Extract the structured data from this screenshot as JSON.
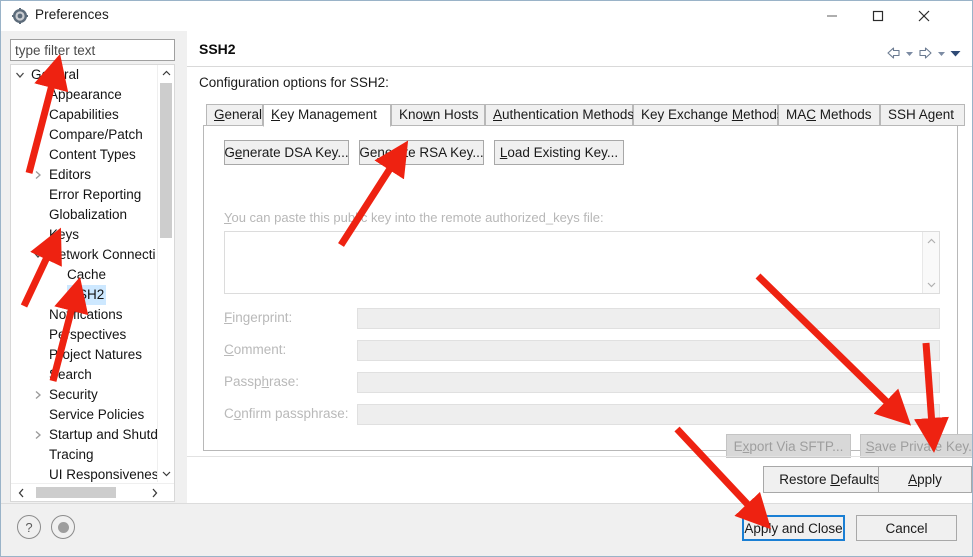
{
  "window": {
    "title": "Preferences",
    "icon": "preferences-gear-icon",
    "minimize_label": "Minimize",
    "maximize_label": "Maximize",
    "close_label": "Close"
  },
  "sidebar": {
    "filter": {
      "value": "",
      "placeholder": "type filter text"
    },
    "tree": [
      {
        "label": "General",
        "indent": 0,
        "twisty": "expanded",
        "selected": false
      },
      {
        "label": "Appearance",
        "indent": 1,
        "twisty": "none",
        "selected": false
      },
      {
        "label": "Capabilities",
        "indent": 1,
        "twisty": "none",
        "selected": false
      },
      {
        "label": "Compare/Patch",
        "indent": 1,
        "twisty": "none",
        "selected": false
      },
      {
        "label": "Content Types",
        "indent": 1,
        "twisty": "none",
        "selected": false
      },
      {
        "label": "Editors",
        "indent": 1,
        "twisty": "collapsed",
        "selected": false
      },
      {
        "label": "Error Reporting",
        "indent": 1,
        "twisty": "none",
        "selected": false
      },
      {
        "label": "Globalization",
        "indent": 1,
        "twisty": "none",
        "selected": false
      },
      {
        "label": "Keys",
        "indent": 1,
        "twisty": "none",
        "selected": false
      },
      {
        "label": "Network Connecti",
        "indent": 1,
        "twisty": "expanded",
        "selected": false
      },
      {
        "label": "Cache",
        "indent": 2,
        "twisty": "none",
        "selected": false
      },
      {
        "label": "SSH2",
        "indent": 2,
        "twisty": "none",
        "selected": true
      },
      {
        "label": "Notifications",
        "indent": 1,
        "twisty": "none",
        "selected": false
      },
      {
        "label": "Perspectives",
        "indent": 1,
        "twisty": "none",
        "selected": false
      },
      {
        "label": "Project Natures",
        "indent": 1,
        "twisty": "none",
        "selected": false
      },
      {
        "label": "Search",
        "indent": 1,
        "twisty": "none",
        "selected": false
      },
      {
        "label": "Security",
        "indent": 1,
        "twisty": "collapsed",
        "selected": false
      },
      {
        "label": "Service Policies",
        "indent": 1,
        "twisty": "none",
        "selected": false
      },
      {
        "label": "Startup and Shutd",
        "indent": 1,
        "twisty": "collapsed",
        "selected": false
      },
      {
        "label": "Tracing",
        "indent": 1,
        "twisty": "none",
        "selected": false
      },
      {
        "label": "UI Responsiveness",
        "indent": 1,
        "twisty": "none",
        "selected": false
      }
    ]
  },
  "page": {
    "title": "SSH2",
    "description": "Configuration options for SSH2:",
    "nav": {
      "back": "back-arrow-icon",
      "back_menu": "back-dropdown-icon",
      "forward": "forward-arrow-icon",
      "forward_menu": "forward-dropdown-icon",
      "view_menu": "view-menu-chevron-icon"
    }
  },
  "tabs": [
    {
      "label": "General",
      "mnemonic": "G",
      "active": false
    },
    {
      "label": "Key Management",
      "mnemonic": "K",
      "active": true
    },
    {
      "label": "Known Hosts",
      "mnemonic": "w",
      "active": false
    },
    {
      "label": "Authentication Methods",
      "mnemonic": "A",
      "active": false
    },
    {
      "label": "Key Exchange Methods",
      "mnemonic": "M",
      "active": false
    },
    {
      "label": "MAC Methods",
      "mnemonic": "C",
      "active": false
    },
    {
      "label": "SSH Agent",
      "mnemonic": "",
      "active": false
    }
  ],
  "key_management": {
    "buttons": [
      {
        "label": "Generate DSA Key...",
        "mnemonic": "e",
        "disabled": false
      },
      {
        "label": "Generate RSA Key...",
        "mnemonic": "n",
        "disabled": false
      },
      {
        "label": "Load Existing Key...",
        "mnemonic": "L",
        "disabled": false
      }
    ],
    "paste_hint": "You can paste this public key into the remote authorized_keys file:",
    "paste_hint_mnemonic": "Y",
    "public_key_value": "",
    "fields": [
      {
        "label": "Fingerprint:",
        "mnemonic": "F",
        "value": "",
        "disabled": true
      },
      {
        "label": "Comment:",
        "mnemonic": "C",
        "value": "",
        "disabled": true
      },
      {
        "label": "Passphrase:",
        "mnemonic": "h",
        "value": "",
        "disabled": true
      },
      {
        "label": "Confirm passphrase:",
        "mnemonic": "o",
        "value": "",
        "disabled": true
      }
    ],
    "export_button": {
      "label": "Export Via SFTP...",
      "mnemonic": "x",
      "disabled": true
    },
    "save_button": {
      "label": "Save Private Key...",
      "mnemonic": "S",
      "disabled": true
    }
  },
  "page_buttons": {
    "restore_defaults": {
      "label": "Restore Defaults",
      "mnemonic": "D"
    },
    "apply": {
      "label": "Apply",
      "mnemonic": "A"
    }
  },
  "footer": {
    "help_icon": "help-question-icon",
    "second_icon": "bullet-circle-icon",
    "apply_and_close": "Apply and Close",
    "cancel": "Cancel"
  },
  "annotations": {
    "color": "#ee2211",
    "arrow_targets": [
      "general-tree-item",
      "network-connections-tree-item",
      "ssh2-tree-item",
      "generate-rsa-key-button",
      "save-private-key-button",
      "apply-button",
      "apply-and-close-button"
    ]
  }
}
